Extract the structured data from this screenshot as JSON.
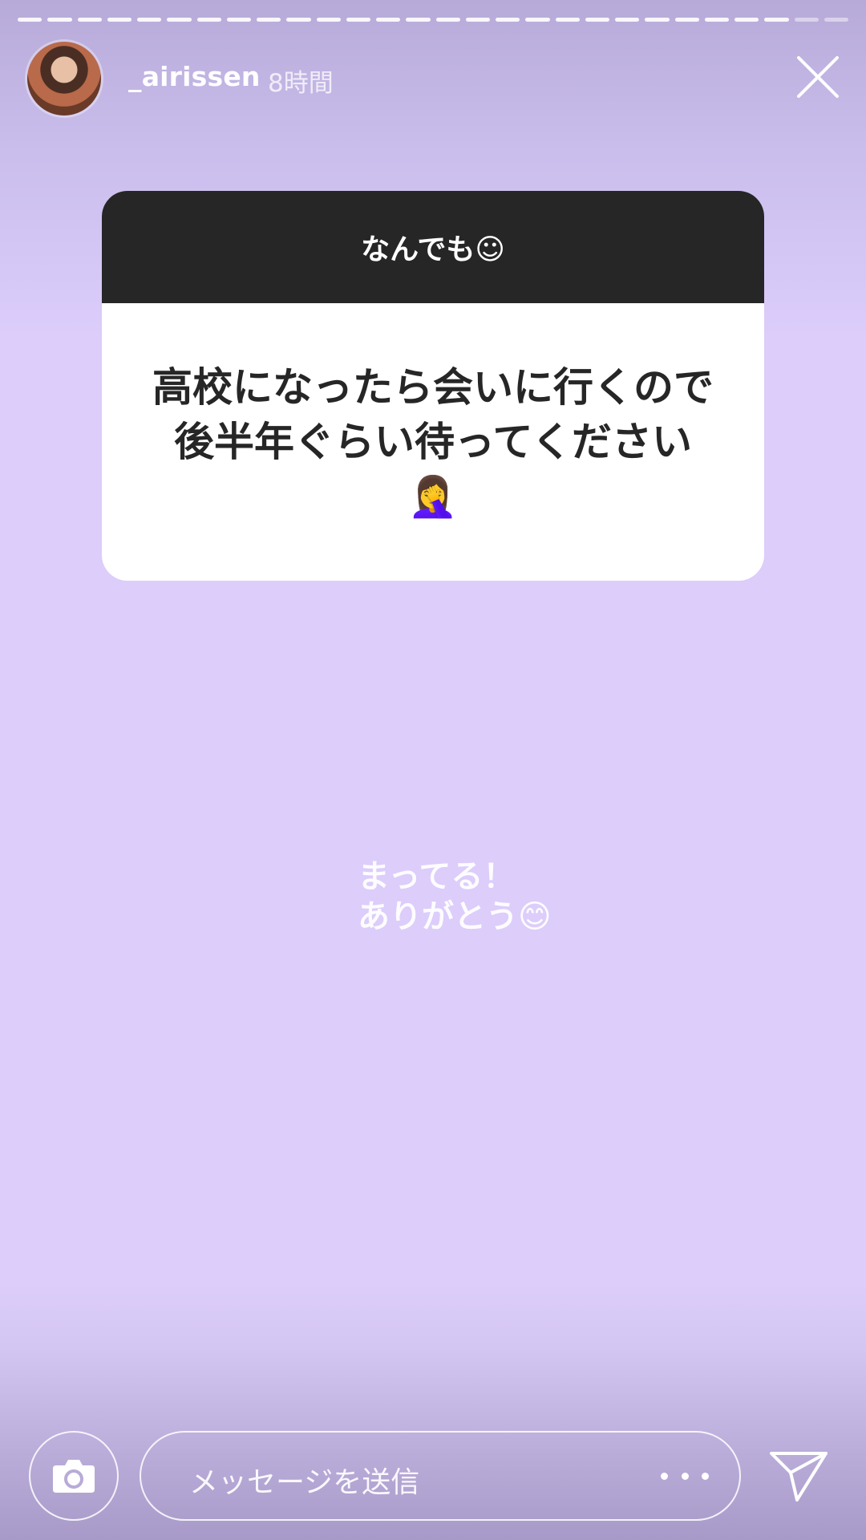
{
  "story": {
    "username": "_airissen",
    "time": "8時間",
    "segments_total": 28,
    "segments_viewed": 26
  },
  "question": {
    "prompt": "なんでも☺",
    "text": "高校になったら会いに行くので後半年ぐらい待ってください🤦‍♀️"
  },
  "reply": {
    "text": "まってる！\nありがとう😊"
  },
  "footer": {
    "message_placeholder": "メッセージを送信"
  },
  "icons": {
    "close": "close-icon",
    "camera": "camera-icon",
    "more": "more-icon",
    "send": "send-icon"
  }
}
